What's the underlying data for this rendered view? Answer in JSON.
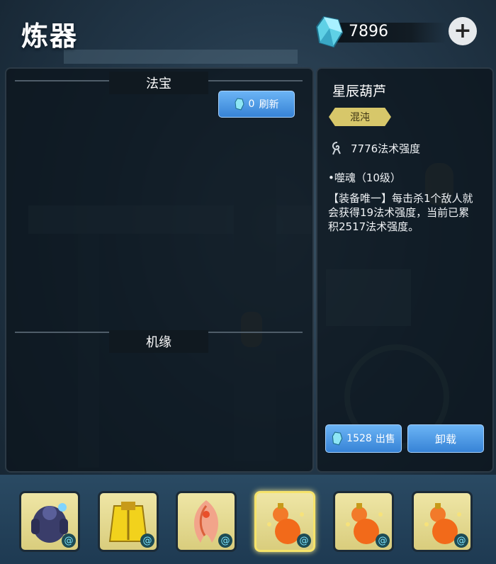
{
  "header": {
    "title": "炼器"
  },
  "currency": {
    "icon": "crystal-gem-icon",
    "amount": "7896",
    "add_icon": "plus-icon"
  },
  "left_panel": {
    "section1_title": "法宝",
    "refresh": {
      "cost": "0",
      "label": "刷新",
      "icon": "crystal-gem-icon"
    },
    "section2_title": "机缘"
  },
  "item_detail": {
    "name": "星辰葫芦",
    "quality": "混沌",
    "stat": {
      "icon": "magic-swirl-icon",
      "text": "7776法术强度"
    },
    "skill_title": "•噬魂（10级）",
    "skill_desc": "【装备唯一】每击杀1个敌人就会获得19法术强度，当前已累积2517法术强度。",
    "sell": {
      "price": "1528",
      "label": "出售",
      "icon": "crystal-gem-icon"
    },
    "unload_label": "卸载"
  },
  "inventory": {
    "items": [
      {
        "name": "armored-golem-icon",
        "selected": false
      },
      {
        "name": "golden-robe-icon",
        "selected": false
      },
      {
        "name": "phoenix-feather-icon",
        "selected": false
      },
      {
        "name": "gourd-icon",
        "selected": true
      },
      {
        "name": "gourd-icon",
        "selected": false
      },
      {
        "name": "gourd-icon",
        "selected": false
      }
    ],
    "badge_icon": "magic-swirl-icon"
  }
}
